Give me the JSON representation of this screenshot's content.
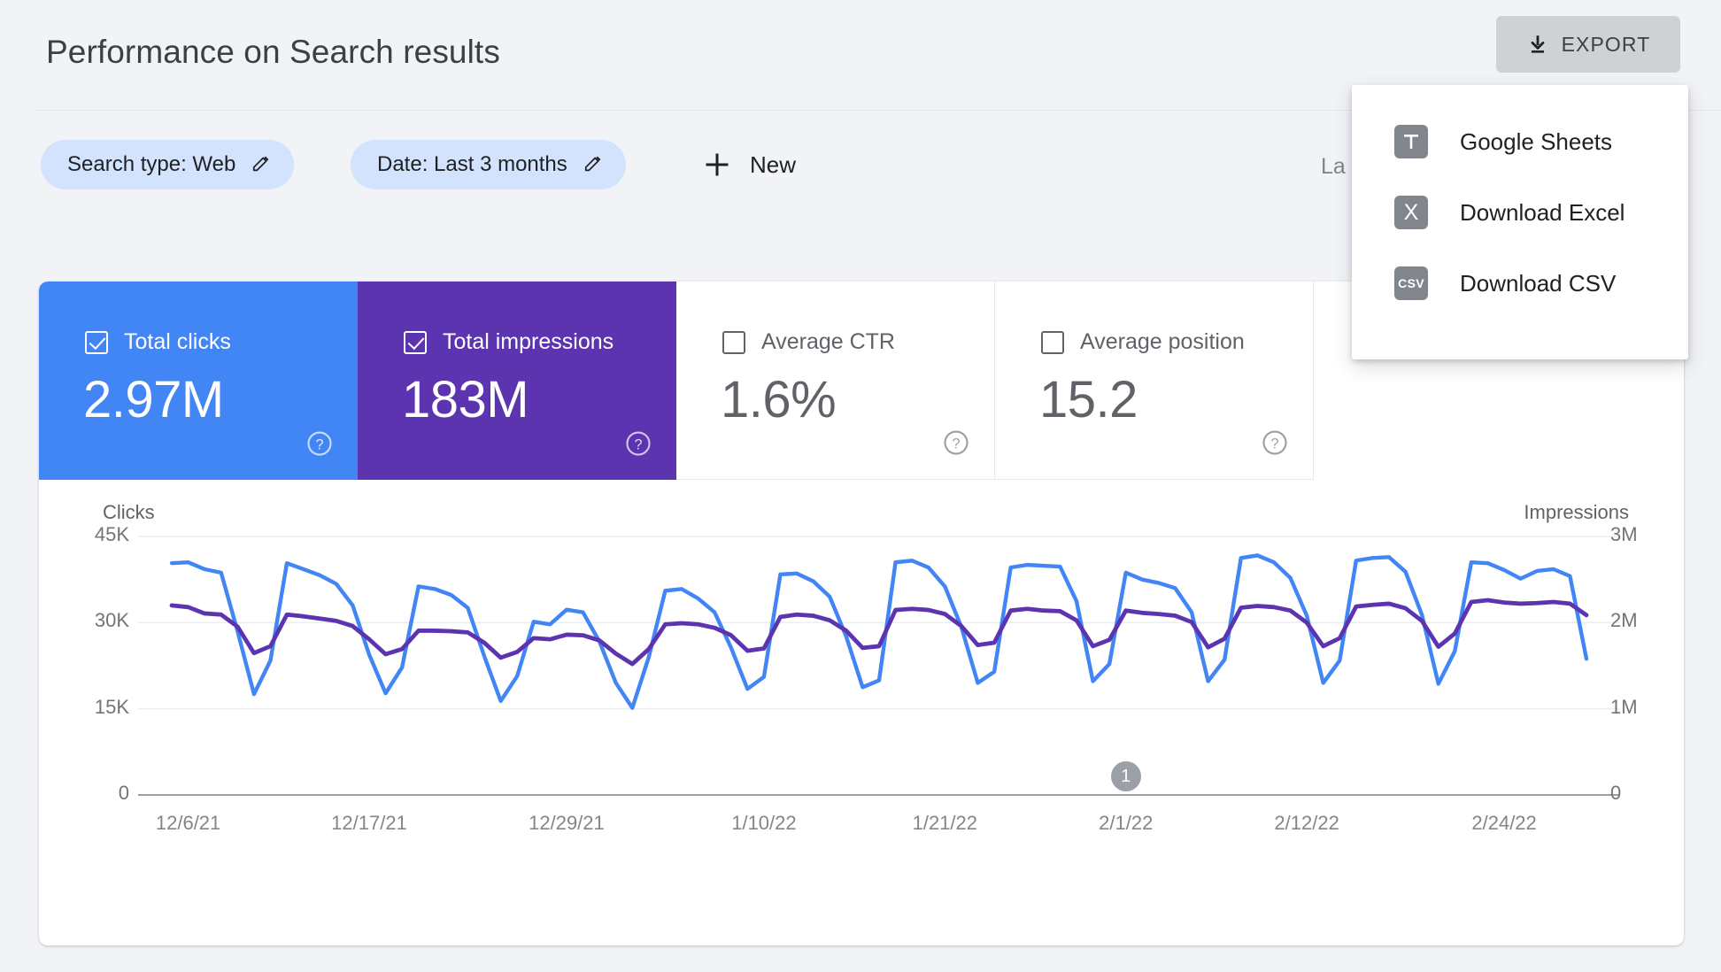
{
  "header": {
    "title": "Performance on Search results",
    "export_label": "EXPORT",
    "export_icon": "download-icon"
  },
  "export_menu": {
    "items": [
      {
        "label": "Google Sheets",
        "icon": "google-sheets-icon",
        "glyph": ""
      },
      {
        "label": "Download Excel",
        "icon": "excel-icon",
        "glyph": "X"
      },
      {
        "label": "Download CSV",
        "icon": "csv-icon",
        "glyph": "CSV"
      }
    ]
  },
  "filters": {
    "search_type_chip": "Search type: Web",
    "date_chip": "Date: Last 3 months",
    "new_label": "New",
    "last_updated": "La",
    "edit_icon": "pencil-icon",
    "add_icon": "plus-icon"
  },
  "metrics": [
    {
      "label": "Total clicks",
      "value": "2.97M",
      "selected": true,
      "color": "#4285f4"
    },
    {
      "label": "Total impressions",
      "value": "183M",
      "selected": true,
      "color": "#5c34b0"
    },
    {
      "label": "Average CTR",
      "value": "1.6%",
      "selected": false,
      "color": "#ffffff"
    },
    {
      "label": "Average position",
      "value": "15.2",
      "selected": false,
      "color": "#ffffff"
    }
  ],
  "chart_data": {
    "type": "line",
    "title": "",
    "xlabel": "",
    "ylabel": "Clicks",
    "y2label": "Impressions",
    "grid": true,
    "legend": "none",
    "ylim": [
      0,
      45000
    ],
    "y2lim": [
      0,
      3000000
    ],
    "yticks": [
      "0",
      "15K",
      "30K",
      "45K"
    ],
    "ytick_values": [
      0,
      15000,
      30000,
      45000
    ],
    "y2ticks": [
      "0",
      "1M",
      "2M",
      "3M"
    ],
    "y2tick_values": [
      0,
      1000000,
      2000000,
      3000000
    ],
    "xticks": [
      "12/6/21",
      "12/17/21",
      "12/29/21",
      "1/10/22",
      "1/21/22",
      "2/1/22",
      "2/12/22",
      "2/24/22"
    ],
    "xtick_indices": [
      1,
      12,
      24,
      36,
      47,
      58,
      69,
      81
    ],
    "annotations": [
      {
        "label": "1",
        "x_index": 58,
        "x_label": "2/1/22"
      }
    ],
    "series": [
      {
        "name": "Impressions",
        "color": "#4285f4",
        "axis": "right",
        "unit": "impressions",
        "values": [
          2690000,
          2700000,
          2620000,
          2580000,
          1900000,
          1170000,
          1560000,
          2690000,
          2620000,
          2550000,
          2450000,
          2200000,
          1630000,
          1180000,
          1480000,
          2420000,
          2390000,
          2320000,
          2170000,
          1610000,
          1090000,
          1380000,
          2010000,
          1980000,
          2150000,
          2120000,
          1780000,
          1300000,
          1010000,
          1600000,
          2370000,
          2390000,
          2280000,
          2120000,
          1710000,
          1230000,
          1370000,
          2560000,
          2570000,
          2480000,
          2300000,
          1840000,
          1250000,
          1330000,
          2700000,
          2720000,
          2640000,
          2420000,
          1950000,
          1300000,
          1430000,
          2640000,
          2670000,
          2660000,
          2650000,
          2250000,
          1320000,
          1520000,
          2580000,
          2500000,
          2460000,
          2400000,
          2120000,
          1320000,
          1570000,
          2750000,
          2780000,
          2700000,
          2520000,
          2080000,
          1300000,
          1560000,
          2720000,
          2750000,
          2760000,
          2590000,
          2090000,
          1290000,
          1670000,
          2700000,
          2690000,
          2610000,
          2510000,
          2600000,
          2620000,
          2540000,
          1580000
        ]
      },
      {
        "name": "Clicks",
        "color": "#5c34b0",
        "axis": "left",
        "unit": "clicks",
        "values": [
          33000,
          32700,
          31600,
          31400,
          29300,
          24700,
          25900,
          31400,
          31100,
          30700,
          30300,
          29400,
          27100,
          24500,
          25400,
          28600,
          28600,
          28500,
          28300,
          26500,
          23900,
          24900,
          27300,
          27100,
          27900,
          27800,
          26900,
          24600,
          22800,
          25400,
          29700,
          29900,
          29700,
          29100,
          27800,
          25100,
          25500,
          31000,
          31400,
          31200,
          30400,
          28600,
          25600,
          25900,
          32200,
          32400,
          32200,
          31500,
          29400,
          26100,
          26500,
          32100,
          32400,
          32100,
          32000,
          30400,
          25900,
          27000,
          32100,
          31700,
          31500,
          31200,
          30100,
          25700,
          27200,
          32600,
          32900,
          32700,
          32100,
          30000,
          25900,
          27300,
          32800,
          33100,
          33300,
          32500,
          30300,
          25800,
          28100,
          33600,
          33900,
          33500,
          33300,
          33400,
          33600,
          33300,
          31300
        ]
      }
    ]
  }
}
